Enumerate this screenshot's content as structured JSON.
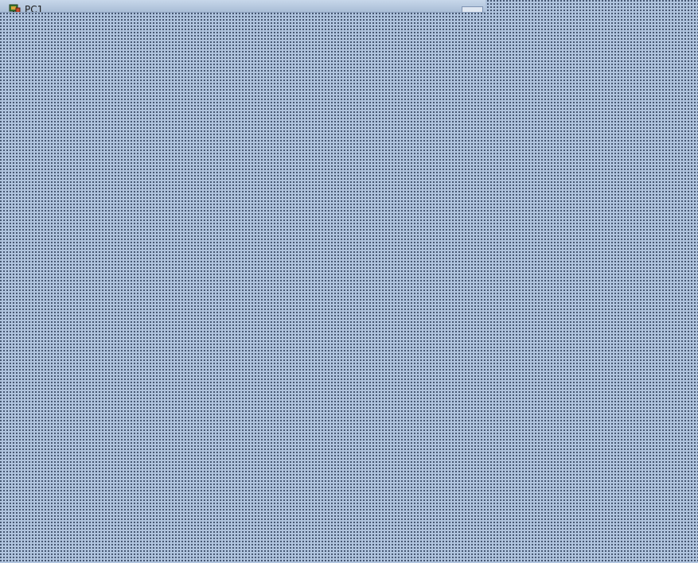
{
  "window": {
    "title": "PC1",
    "app_icon": "network-device-icon",
    "field_value": ""
  },
  "colors": {
    "desktop_background": "#b0c4de",
    "dot_pattern": "#2a3a55",
    "titlebar": "#a9bdd6"
  }
}
